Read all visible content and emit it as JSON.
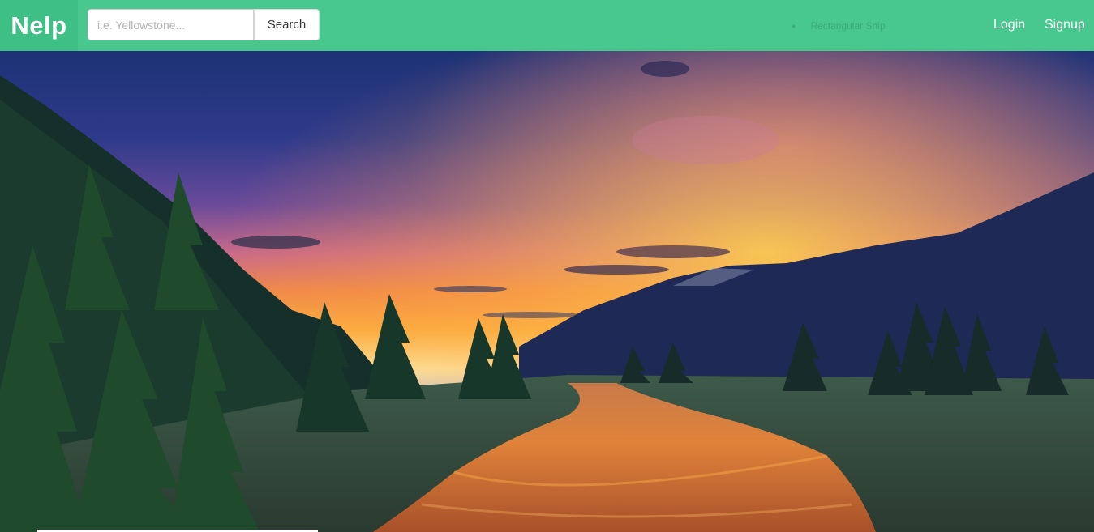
{
  "brand": {
    "name": "Nelp"
  },
  "search": {
    "placeholder": "i.e. Yellowstone...",
    "value": "",
    "button_label": "Search"
  },
  "overlay": {
    "snip_label": "Rectangular Snip"
  },
  "nav": {
    "login_label": "Login",
    "signup_label": "Signup"
  },
  "colors": {
    "navbar": "#48c78e",
    "brand_bg": "#3ebf85"
  },
  "hero": {
    "description_icon": "landscape-photo"
  }
}
